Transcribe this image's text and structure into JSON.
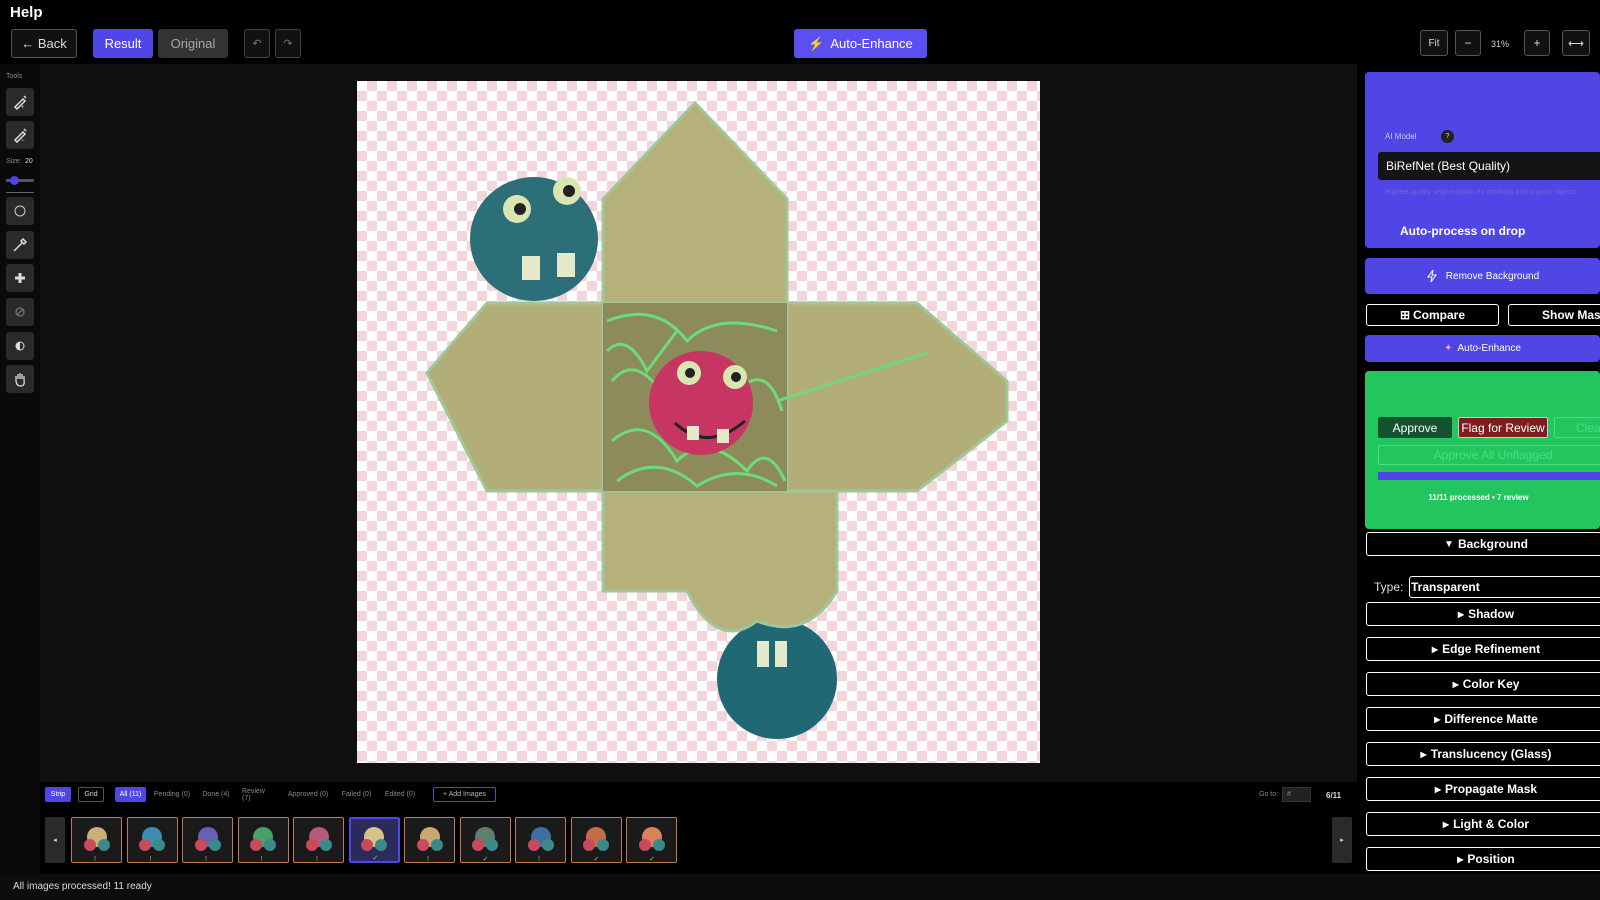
{
  "help": "Help",
  "toolbar": {
    "back": "← Back",
    "result": "Result",
    "original": "Original",
    "undo": "↶",
    "redo": "↷",
    "auto_enhance": "Auto-Enhance",
    "fit": "Fit",
    "zoom_out": "−",
    "zoom": "31%",
    "zoom_in": "+",
    "fit_width": "⟷"
  },
  "tools": {
    "label": "Tools",
    "size_label": "Size:",
    "size_value": "20",
    "size_fraction": 0.2
  },
  "strip": {
    "tabs": {
      "strip": "Strip",
      "grid": "Grid",
      "all": "All (11)",
      "pending": "Pending (0)",
      "done": "Done (4)",
      "review": "Review (7)",
      "approved": "Approved (0)",
      "failed": "Failed (0)",
      "edited": "Edited (0)",
      "add": "+ Add Images"
    },
    "goto_label": "Go to:",
    "goto_placeholder": "#",
    "count": "6/11",
    "prev": "◂",
    "next": "▸",
    "thumbnails": [
      {
        "check": "!"
      },
      {
        "check": "!"
      },
      {
        "check": "!"
      },
      {
        "check": "!"
      },
      {
        "check": "!"
      },
      {
        "check": "✓"
      },
      {
        "check": "!"
      },
      {
        "check": "✓"
      },
      {
        "check": "!"
      },
      {
        "check": "✓"
      },
      {
        "check": "✓"
      }
    ]
  },
  "status": "All images processed! 11 ready",
  "panel": {
    "ai_model_label": "AI Model",
    "help_symbol": "?",
    "model": "BiRefNet (Best Quality)",
    "model_hint": "Highest quality segmentation for products and organic objects",
    "auto_process": "Auto-process on drop",
    "remove_bg": "Remove Background",
    "compare": "Compare",
    "show_mask": "Show Mask",
    "auto_enhance": "Auto-Enhance",
    "approve": "Approve",
    "flag": "Flag for Review",
    "clear": "Clear",
    "approve_all": "Approve All Unflagged",
    "progress_fraction": 1,
    "progress_text": "11/11 processed • 7 review",
    "background": "Background",
    "type_label": "Type:",
    "type_value": "Transparent",
    "sections": [
      "Shadow",
      "Edge Refinement",
      "Color Key",
      "Difference Matte",
      "Translucency (Glass)",
      "Propagate Mask",
      "Light & Color",
      "Position"
    ]
  },
  "colors": {
    "accent": "#4f46e5",
    "approve_green": "#22c55e",
    "flag_red": "#7f1d1d"
  }
}
